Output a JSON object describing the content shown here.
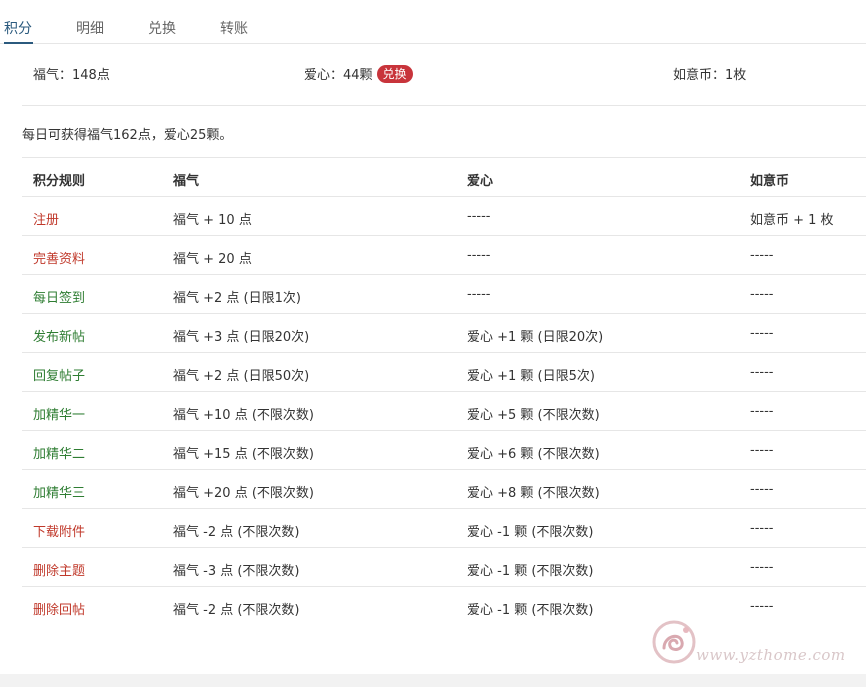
{
  "tabs": [
    {
      "label": "积分",
      "active": true
    },
    {
      "label": "明细",
      "active": false
    },
    {
      "label": "兑换",
      "active": false
    },
    {
      "label": "转账",
      "active": false
    }
  ],
  "summary": {
    "fuqi": "福气：148点",
    "aixin": "爱心：44颗",
    "exchange_label": "兑换",
    "ruyibi": "如意币：1枚"
  },
  "daily_note": "每日可获得福气162点，爱心25颗。",
  "table": {
    "headers": [
      "积分规则",
      "福气",
      "爱心",
      "如意币"
    ],
    "rows": [
      {
        "rule": "注册",
        "color": "#c0392b",
        "fuqi": "福气 + 10 点",
        "aixin": "-----",
        "ruyibi": "如意币 + 1 枚"
      },
      {
        "rule": "完善资料",
        "color": "#c0392b",
        "fuqi": "福气 + 20 点",
        "aixin": "-----",
        "ruyibi": "-----"
      },
      {
        "rule": "每日签到",
        "color": "#2e7d32",
        "fuqi": "福气 +2 点 (日限1次)",
        "aixin": "-----",
        "ruyibi": "-----"
      },
      {
        "rule": "发布新帖",
        "color": "#2e7d32",
        "fuqi": "福气 +3 点 (日限20次)",
        "aixin": "爱心 +1 颗 (日限20次)",
        "ruyibi": "-----"
      },
      {
        "rule": "回复帖子",
        "color": "#2e7d32",
        "fuqi": "福气 +2 点 (日限50次)",
        "aixin": "爱心 +1 颗 (日限5次)",
        "ruyibi": "-----"
      },
      {
        "rule": "加精华一",
        "color": "#2e7d32",
        "fuqi": "福气 +10 点 (不限次数)",
        "aixin": "爱心 +5 颗 (不限次数)",
        "ruyibi": "-----"
      },
      {
        "rule": "加精华二",
        "color": "#2e7d32",
        "fuqi": "福气 +15 点 (不限次数)",
        "aixin": "爱心 +6 颗 (不限次数)",
        "ruyibi": "-----"
      },
      {
        "rule": "加精华三",
        "color": "#2e7d32",
        "fuqi": "福气 +20 点 (不限次数)",
        "aixin": "爱心 +8 颗 (不限次数)",
        "ruyibi": "-----"
      },
      {
        "rule": "下载附件",
        "color": "#c0392b",
        "fuqi": "福气 -2 点 (不限次数)",
        "aixin": "爱心 -1 颗 (不限次数)",
        "ruyibi": "-----"
      },
      {
        "rule": "删除主题",
        "color": "#c0392b",
        "fuqi": "福气 -3 点 (不限次数)",
        "aixin": "爱心 -1 颗 (不限次数)",
        "ruyibi": "-----"
      },
      {
        "rule": "删除回帖",
        "color": "#c0392b",
        "fuqi": "福气 -2 点 (不限次数)",
        "aixin": "爱心 -1 颗 (不限次数)",
        "ruyibi": "-----"
      }
    ]
  },
  "watermark": {
    "text": "www.yzthome.com"
  },
  "colors": {
    "accent": "#2b5a7e",
    "badge": "#c8343b",
    "rule_red": "#c0392b",
    "rule_green": "#2e7d32"
  }
}
